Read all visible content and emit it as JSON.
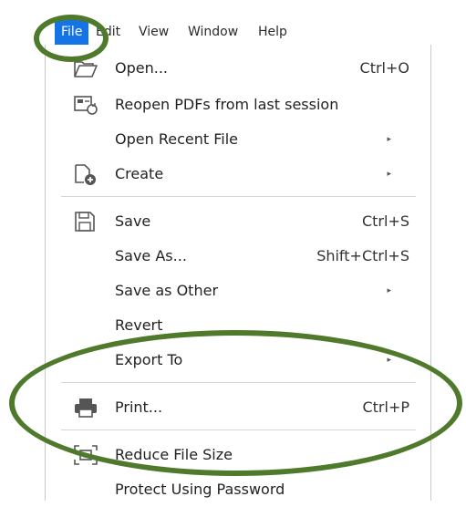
{
  "menubar": {
    "items": [
      {
        "label": "File"
      },
      {
        "label": "Edit"
      },
      {
        "label": "View"
      },
      {
        "label": "Window"
      },
      {
        "label": "Help"
      }
    ]
  },
  "menu": {
    "items": [
      {
        "label": "Open...",
        "shortcut": "Ctrl+O",
        "icon": "folder-open-icon"
      },
      {
        "label": "Reopen PDFs from last session",
        "icon": "reopen-icon"
      },
      {
        "label": "Open Recent File",
        "submenu": true
      },
      {
        "label": "Create",
        "submenu": true,
        "icon": "create-pdf-icon"
      },
      {
        "label": "Save",
        "shortcut": "Ctrl+S",
        "icon": "floppy-disk-icon"
      },
      {
        "label": "Save As...",
        "shortcut": "Shift+Ctrl+S"
      },
      {
        "label": "Save as Other",
        "submenu": true
      },
      {
        "label": "Revert"
      },
      {
        "label": "Export To",
        "submenu": true
      },
      {
        "label": "Print...",
        "shortcut": "Ctrl+P",
        "icon": "printer-icon"
      },
      {
        "label": "Reduce File Size",
        "icon": "reduce-size-icon"
      },
      {
        "label": "Protect Using Password"
      }
    ]
  },
  "colors": {
    "active_menu_bg": "#1473e6",
    "annotation": "#4f7a2c"
  },
  "submenu_arrow": "▸"
}
